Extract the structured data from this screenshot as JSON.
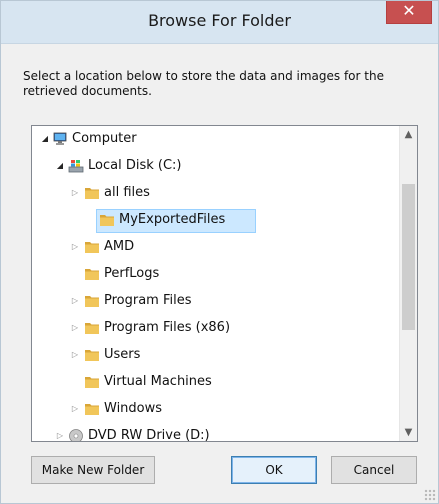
{
  "window": {
    "title": "Browse For Folder",
    "close_glyph": "✕",
    "description": "Select a location below to store the data and images for the retrieved documents."
  },
  "tree": {
    "items": [
      {
        "label": "Computer",
        "icon": "computer-icon",
        "expander": "expanded"
      },
      {
        "label": "Local Disk (C:)",
        "icon": "drive-icon",
        "expander": "expanded"
      },
      {
        "label": "all files",
        "icon": "folder-icon",
        "expander": "collapsed"
      },
      {
        "label": "MyExportedFiles",
        "icon": "folder-icon",
        "expander": "none",
        "selected": true
      },
      {
        "label": "AMD",
        "icon": "folder-icon",
        "expander": "collapsed"
      },
      {
        "label": "PerfLogs",
        "icon": "folder-icon",
        "expander": "none"
      },
      {
        "label": "Program Files",
        "icon": "folder-icon",
        "expander": "collapsed"
      },
      {
        "label": "Program Files (x86)",
        "icon": "folder-icon",
        "expander": "collapsed"
      },
      {
        "label": "Users",
        "icon": "folder-icon",
        "expander": "collapsed"
      },
      {
        "label": "Virtual Machines",
        "icon": "folder-icon",
        "expander": "none"
      },
      {
        "label": "Windows",
        "icon": "folder-icon",
        "expander": "collapsed"
      },
      {
        "label": "DVD RW Drive (D:)",
        "icon": "dvd-drive-icon",
        "expander": "collapsed"
      }
    ]
  },
  "buttons": {
    "make_new_folder": "Make New Folder",
    "ok": "OK",
    "cancel": "Cancel"
  },
  "colors": {
    "titlebar": "#d7e5f1",
    "close_button": "#c75050",
    "selection_fill": "#cce8ff",
    "selection_border": "#99d1ff",
    "folder": "#e8b84a"
  }
}
